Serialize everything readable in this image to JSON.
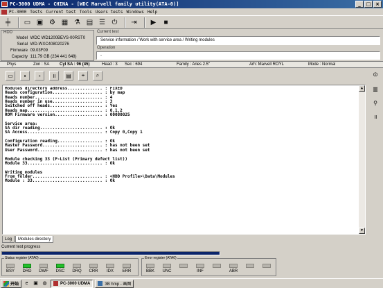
{
  "window": {
    "title": "PC-3000 UDMA - CHINA - [WDC Marvell family utility(ATA-0)]",
    "controls": [
      "_",
      "□",
      "×"
    ]
  },
  "menu": [
    "PC-3000",
    "Tests",
    "Current test",
    "Tools",
    "Users tests",
    "Windows",
    "Help"
  ],
  "hdd": {
    "caption": "HDD",
    "fields": [
      {
        "key": "Model",
        "value": "WDC WD1200BEVS-00RST0"
      },
      {
        "key": "Serial",
        "value": "WD-WXC408020276"
      },
      {
        "key": "Firmware",
        "value": "09.03F09"
      },
      {
        "key": "Capacity",
        "value": "111.79 GB (234 441 648)"
      }
    ]
  },
  "current_test": {
    "caption": "Current test",
    "value": "Service information / Work with service area / Writing modules",
    "operation_caption": "Operation",
    "operation_value": "-"
  },
  "status_line": {
    "phys": "Phys",
    "zone": "Zon : SA",
    "cyl": "Cyl SA : 96 (45)",
    "head": "Head : 3",
    "sec": "Sec : 694",
    "family": "Family : Aries 2.5\"",
    "arh": "Arh: Marvell ROYL",
    "mode": "Mode : Normal"
  },
  "log_lines": [
    "Modules directory address.............. : FIXED",
    "Heads configuration.................... : by map",
    "Heads number........................... : 4",
    "Heads number in use.................... : 3",
    "Switched off heads..................... : Yes",
    "Heads map.............................. : 0,1,2",
    "ROM Firmware version................... : 00080025",
    "",
    "Service area:",
    "SA dir reading......................... : Ok",
    "SA Access.............................. : Copy 0,Copy 1",
    "",
    "Configuration reading.................. : Ok",
    "Master Password........................ : has not been set",
    "User Password.......................... : has not been set",
    "",
    "Module checking 33 (P-List (Primary defect list))",
    "Module 33.............................. : Ok",
    "",
    "Writing modules",
    "From folder............................ : <HDD Profile>\\Data\\Modules",
    "Module : 33............................ : Ok"
  ],
  "tabs": {
    "log": "Log",
    "modules": "Modules directory"
  },
  "progress": {
    "label": "Current test progress",
    "value": 1.0
  },
  "status_register": {
    "caption": "Status register (ATA0)",
    "leds": [
      {
        "label": "BSY",
        "on": false
      },
      {
        "label": "DRD",
        "on": true
      },
      {
        "label": "DWF",
        "on": false
      },
      {
        "label": "DSC",
        "on": true
      },
      {
        "label": "DRQ",
        "on": false
      },
      {
        "label": "CRR",
        "on": false
      },
      {
        "label": "IDX",
        "on": false
      },
      {
        "label": "ERR",
        "on": false
      }
    ]
  },
  "error_register": {
    "caption": "Error register (ATA0)",
    "leds": [
      {
        "label": "BBK",
        "on": false
      },
      {
        "label": "UNC",
        "on": false
      },
      {
        "label": "",
        "on": false
      },
      {
        "label": "INF",
        "on": false
      },
      {
        "label": "",
        "on": false
      },
      {
        "label": "ABR",
        "on": false
      },
      {
        "label": "",
        "on": false
      },
      {
        "label": "",
        "on": false
      }
    ]
  },
  "taskbar": {
    "start": "开始",
    "tasks": [
      {
        "label": "PC-3000 UDMA"
      },
      {
        "label": "3B hmp - 画图"
      }
    ]
  },
  "colors": {
    "accent": "#0a246a",
    "led_on": "#22c02a"
  }
}
